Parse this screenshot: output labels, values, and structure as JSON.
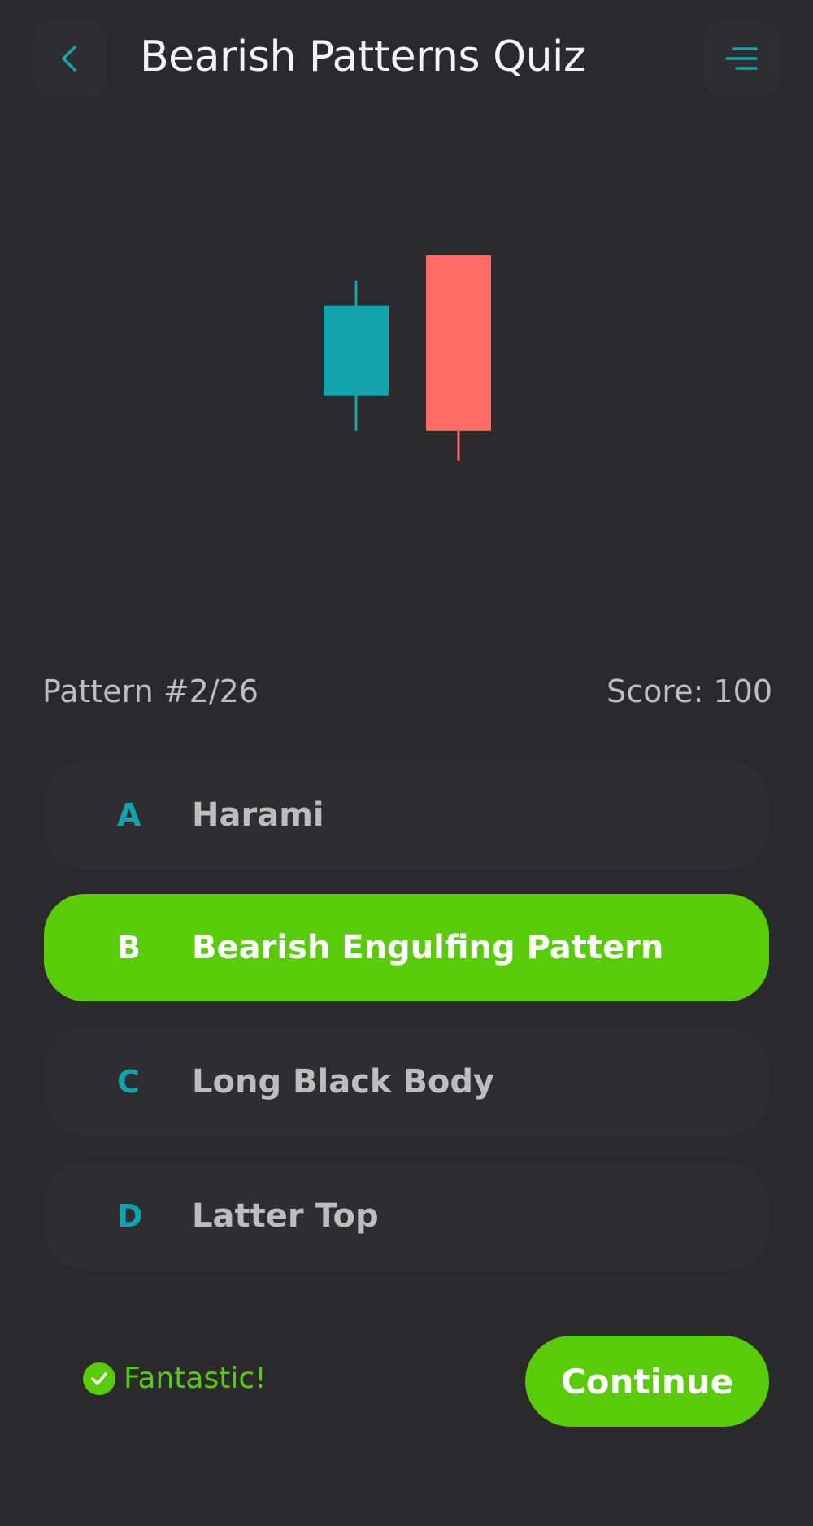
{
  "header": {
    "title": "Bearish Patterns Quiz",
    "back_icon": "chevron-left-icon",
    "menu_icon": "menu-icon"
  },
  "chart_data": {
    "type": "candlestick",
    "candles": [
      {
        "direction": "bullish",
        "open": 40,
        "close": 58,
        "low": 33,
        "high": 63,
        "color": "#12a4ad"
      },
      {
        "direction": "bearish",
        "open": 68,
        "close": 33,
        "low": 27,
        "high": 68,
        "color": "#ff6b65"
      }
    ]
  },
  "status": {
    "pattern": "Pattern #2/26",
    "score": "Score: 100"
  },
  "options": [
    {
      "letter": "A",
      "text": "Harami",
      "selected": false
    },
    {
      "letter": "B",
      "text": "Bearish Engulfing Pattern",
      "selected": true
    },
    {
      "letter": "C",
      "text": "Long Black Body",
      "selected": false
    },
    {
      "letter": "D",
      "text": "Latter Top",
      "selected": false
    }
  ],
  "footer": {
    "feedback": "Fantastic!",
    "feedback_icon": "check-circle-icon",
    "continue_label": "Continue"
  },
  "colors": {
    "background": "#2a2a2c",
    "accent_teal": "#12a4ad",
    "success_green": "#58cc08",
    "bearish_red": "#ff6b65"
  }
}
